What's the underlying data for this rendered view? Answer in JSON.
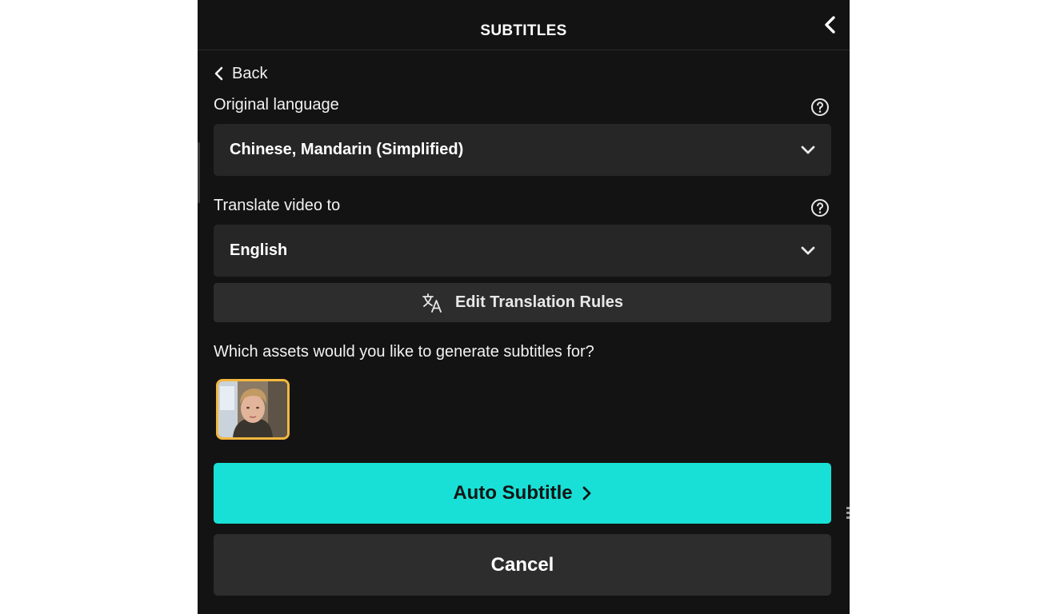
{
  "header": {
    "title": "SUBTITLES",
    "collapse_icon": "chevron-left-icon"
  },
  "back": {
    "label": "Back",
    "icon": "chevron-left-icon"
  },
  "original_language": {
    "label": "Original language",
    "value": "Chinese, Mandarin (Simplified)",
    "help_icon": "question-circle-icon"
  },
  "translate": {
    "label": "Translate video to",
    "value": "English",
    "help_icon": "question-circle-icon"
  },
  "edit_rules": {
    "label": "Edit Translation Rules",
    "icon": "translate-icon"
  },
  "assets": {
    "question": "Which assets would you like to generate subtitles for?",
    "selected_border_color": "#f4b73f"
  },
  "actions": {
    "auto_subtitle_label": "Auto Subtitle",
    "auto_subtitle_color": "#19e0d6",
    "cancel_label": "Cancel"
  }
}
